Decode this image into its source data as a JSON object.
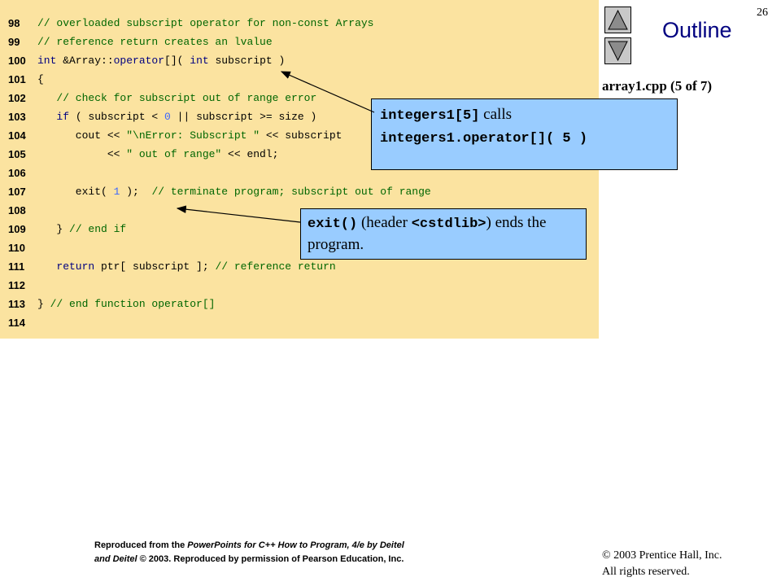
{
  "slide": {
    "page_number": "26",
    "outline_title": "Outline",
    "file_caption": "array1.cpp (5 of 7)"
  },
  "code_lines": [
    {
      "num": "98",
      "parts": [
        {
          "t": "// overloaded subscript operator for non-const Arrays",
          "c": "cm"
        }
      ]
    },
    {
      "num": "99",
      "parts": [
        {
          "t": "// reference return creates an lvalue",
          "c": "cm"
        }
      ]
    },
    {
      "num": "100",
      "parts": [
        {
          "t": "int",
          "c": "kw"
        },
        {
          "t": " &Array::",
          "c": ""
        },
        {
          "t": "operator",
          "c": "kw"
        },
        {
          "t": "[]( ",
          "c": ""
        },
        {
          "t": "int",
          "c": "kw"
        },
        {
          "t": " subscript )",
          "c": ""
        }
      ]
    },
    {
      "num": "101",
      "parts": [
        {
          "t": "{",
          "c": ""
        }
      ]
    },
    {
      "num": "102",
      "parts": [
        {
          "t": "   // check for subscript out of range error",
          "c": "cm"
        }
      ]
    },
    {
      "num": "103",
      "parts": [
        {
          "t": "   ",
          "c": ""
        },
        {
          "t": "if",
          "c": "kw"
        },
        {
          "t": " ( subscript < ",
          "c": ""
        },
        {
          "t": "0",
          "c": "nm"
        },
        {
          "t": " || subscript >= size )",
          "c": ""
        }
      ]
    },
    {
      "num": "104",
      "parts": [
        {
          "t": "      cout << ",
          "c": ""
        },
        {
          "t": "\"\\nError: Subscript \"",
          "c": "st"
        },
        {
          "t": " << subscript",
          "c": ""
        }
      ]
    },
    {
      "num": "105",
      "parts": [
        {
          "t": "           << ",
          "c": ""
        },
        {
          "t": "\" out of range\"",
          "c": "st"
        },
        {
          "t": " << endl;",
          "c": ""
        }
      ]
    },
    {
      "num": "106",
      "parts": []
    },
    {
      "num": "107",
      "parts": [
        {
          "t": "      exit( ",
          "c": ""
        },
        {
          "t": "1",
          "c": "nm"
        },
        {
          "t": " );  ",
          "c": ""
        },
        {
          "t": "// terminate program; subscript out of range",
          "c": "cm"
        }
      ]
    },
    {
      "num": "108",
      "parts": []
    },
    {
      "num": "109",
      "parts": [
        {
          "t": "   } ",
          "c": ""
        },
        {
          "t": "// end if",
          "c": "cm"
        }
      ]
    },
    {
      "num": "110",
      "parts": []
    },
    {
      "num": "111",
      "parts": [
        {
          "t": "   ",
          "c": ""
        },
        {
          "t": "return",
          "c": "kw"
        },
        {
          "t": " ptr[ subscript ]; ",
          "c": ""
        },
        {
          "t": "// reference return",
          "c": "cm"
        }
      ]
    },
    {
      "num": "112",
      "parts": []
    },
    {
      "num": "113",
      "parts": [
        {
          "t": "} ",
          "c": ""
        },
        {
          "t": "// end function operator[]",
          "c": "cm"
        }
      ]
    },
    {
      "num": "114",
      "parts": []
    }
  ],
  "callouts": {
    "first": {
      "line1_code": "integers1[5]",
      "line1_text": " calls",
      "line2_code": "integers1.operator[]( 5 )"
    },
    "second": {
      "code": "exit()",
      "text_before": " (header ",
      "header_code": "<cstdlib>",
      "text_after": ") ends the program."
    }
  },
  "footer": {
    "line1_a": "Reproduced from the ",
    "line1_b": "PowerPoints for C++ How to Program, 4/e by Deitel",
    "line2_a": "and Deitel",
    "line2_b": " © 2003. Reproduced by permission of Pearson Education, Inc."
  },
  "copyright": {
    "line1": "© 2003 Prentice Hall, Inc.",
    "line2": "All rights reserved."
  },
  "colors": {
    "code_background": "#fbe3a0",
    "callout_background": "#99ccff",
    "keyword": "#000080",
    "comment": "#006600",
    "number": "#3a66ff",
    "outline_title": "#000080"
  },
  "icons": {
    "up_button": "triangle-up-icon",
    "down_button": "triangle-down-icon"
  }
}
